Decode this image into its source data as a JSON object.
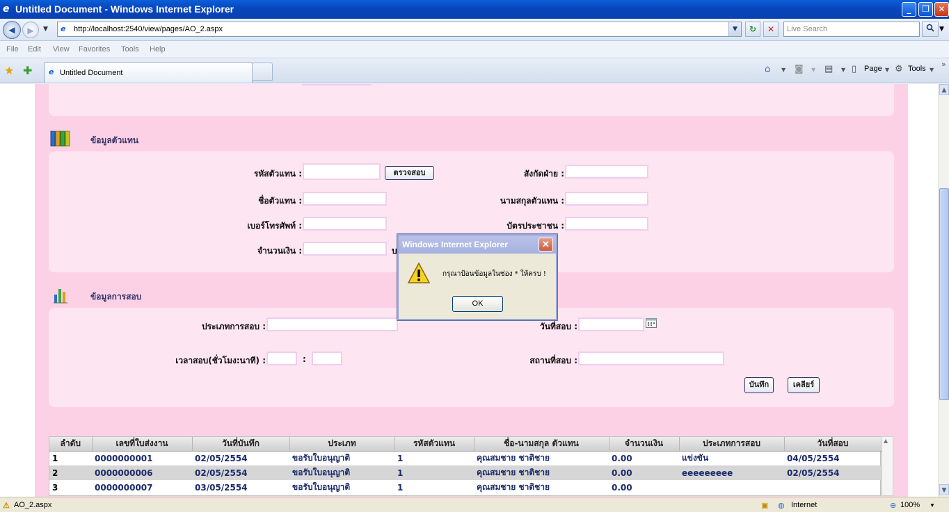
{
  "window": {
    "title": "Untitled Document - Windows Internet Explorer",
    "min_label": "_",
    "max_label": "❐",
    "close_label": "✕"
  },
  "address_bar": {
    "url": "http://localhost:2540/view/pages/AO_2.aspx",
    "search_placeholder": "Live Search"
  },
  "menu": [
    "File",
    "Edit",
    "View",
    "Favorites",
    "Tools",
    "Help"
  ],
  "tab": {
    "title": "Untitled Document"
  },
  "commandbar": {
    "page_label": "Page",
    "tools_label": "Tools"
  },
  "section_agent": {
    "title": "ข้อมูลตัวแทน",
    "agent_code_label": "รหัสตัวแทน :",
    "check_button": "ตรวจสอบ",
    "department_label": "สังกัดฝ่าย :",
    "agent_name_label": "ชื่อตัวแทน :",
    "agent_surname_label": "นามสกุลตัวแทน :",
    "phone_label": "เบอร์โทรศัพท์ :",
    "id_card_label": "บัตรประชาชน :",
    "amount_label": "จำนวนเงิน :",
    "amount_suffix": "บ"
  },
  "section_exam": {
    "title": "ข้อมูลการสอบ",
    "exam_type_label": "ประเภทการสอบ :",
    "exam_date_label": "วันที่สอบ :",
    "exam_time_label": "เวลาสอบ(ชั่วโมง:นาที) :",
    "time_sep": ":",
    "exam_place_label": "สถานที่สอบ :",
    "save_button": "บันทึก",
    "clear_button": "เคลียร์"
  },
  "grid": {
    "headers": [
      "ลำดับ",
      "เลขที่ใบส่งงาน",
      "วันที่บันทึก",
      "ประเภท",
      "รหัสตัวแทน",
      "ชื่อ-นามสกุล ตัวแทน",
      "จำนวนเงิน",
      "ประเภทการสอบ",
      "วันที่สอบ"
    ],
    "rows": [
      [
        "1",
        "0000000001",
        "02/05/2554",
        "ขอรับใบอนุญาติ",
        "1",
        "คุณสมชาย ชาติชาย",
        "0.00",
        "แข่งขัน",
        "04/05/2554"
      ],
      [
        "2",
        "0000000006",
        "02/05/2554",
        "ขอรับใบอนุญาติ",
        "1",
        "คุณสมชาย ชาติชาย",
        "0.00",
        "eeeeeeeee",
        "02/05/2554"
      ],
      [
        "3",
        "0000000007",
        "03/05/2554",
        "ขอรับใบอนุญาติ",
        "1",
        "คุณสมชาย ชาติชาย",
        "0.00",
        "",
        ""
      ]
    ]
  },
  "dialog": {
    "title": "Windows Internet Explorer",
    "message": "กรุณาป้อนข้อมูลในช่อง * ให้ครบ !",
    "ok_button": "OK"
  },
  "statusbar": {
    "page": "AO_2.aspx",
    "zone": "Internet",
    "zoom": "100%"
  }
}
